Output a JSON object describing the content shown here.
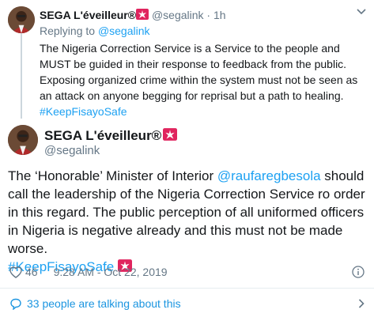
{
  "reply_tweet": {
    "author_name": "SEGA L'éveilleur®",
    "badge_icon": "siren-emoji-icon",
    "handle": "@segalink",
    "separator": "·",
    "time": "1h",
    "replying_prefix": "Replying to",
    "replying_to": "@segalink",
    "text": "The Nigeria Correction Service is a Service to the people and MUST be guided in their response to feedback from the public. Exposing organized crime within the system must not be seen as an attack on anyone begging for reprisal but a path to healing.",
    "hashtag": "#KeepFisayoSafe"
  },
  "main_tweet": {
    "author_name": "SEGA L'éveilleur®",
    "handle": "@segalink",
    "text_part1": "The ‘Honorable’ Minister of Interior ",
    "mention": "@raufaregbesola",
    "text_part2": " should call the leadership of the Nigeria Correction Service ro order in this regard. The public perception of all uniformed officers in Nigeria is negative already and this must not be made worse.",
    "hashtag": "#KeepFisayoSafe",
    "likes": "46",
    "timestamp": "9:28 AM - Oct 22, 2019"
  },
  "conversation": {
    "label": "33 people are talking about this"
  },
  "colors": {
    "link": "#1da1f2",
    "secondary_text": "#657786",
    "primary_text": "#14171a",
    "divider": "#e6ecf0",
    "siren_red": "#e0245e"
  }
}
